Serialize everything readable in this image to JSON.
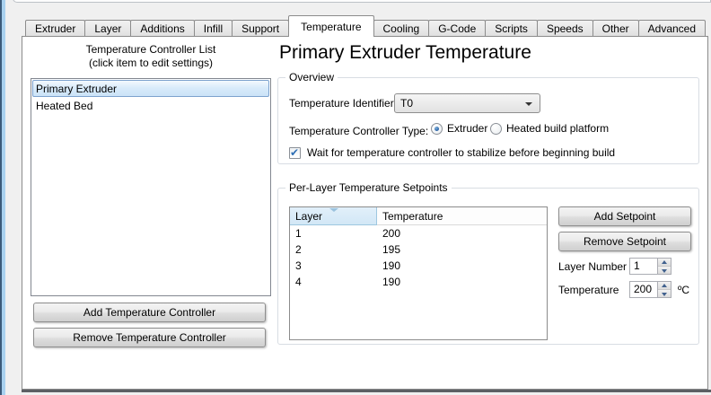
{
  "tabs": {
    "items": [
      "Extruder",
      "Layer",
      "Additions",
      "Infill",
      "Support",
      "Temperature",
      "Cooling",
      "G-Code",
      "Scripts",
      "Speeds",
      "Other",
      "Advanced"
    ],
    "active": "Temperature"
  },
  "left_panel": {
    "title": "Temperature Controller List",
    "subtitle": "(click item to edit settings)",
    "controllers": [
      {
        "label": "Primary Extruder",
        "selected": true
      },
      {
        "label": "Heated Bed",
        "selected": false
      }
    ],
    "add_button": "Add Temperature Controller",
    "remove_button": "Remove Temperature Controller"
  },
  "main": {
    "heading": "Primary Extruder Temperature",
    "overview": {
      "legend": "Overview",
      "identifier_label": "Temperature Identifier",
      "identifier_value": "T0",
      "type_label": "Temperature Controller Type:",
      "type_options": [
        {
          "label": "Extruder",
          "selected": true
        },
        {
          "label": "Heated build platform",
          "selected": false
        }
      ],
      "wait_checkbox": {
        "label": "Wait for temperature controller to stabilize before beginning build",
        "checked": true
      }
    },
    "setpoints": {
      "legend": "Per-Layer Temperature Setpoints",
      "table": {
        "columns": [
          "Layer",
          "Temperature"
        ],
        "sorted_column": "Layer",
        "sort_icon": "sort-indicator",
        "rows": [
          [
            "1",
            "200"
          ],
          [
            "2",
            "195"
          ],
          [
            "3",
            "190"
          ],
          [
            "4",
            "190"
          ]
        ]
      },
      "add_button": "Add Setpoint",
      "remove_button": "Remove Setpoint",
      "layer_number": {
        "label": "Layer Number",
        "value": "1"
      },
      "temperature": {
        "label": "Temperature",
        "value": "200",
        "unit": "ºC"
      }
    }
  },
  "colors": {
    "selection_border": "#7da2ce",
    "selection_fill": "#d7eafa",
    "sorted_header": "#d2e7f6",
    "accent_blue": "#2a62a5",
    "edge_blue": "#a9d1ef",
    "panel_border": "#8c8c8c"
  }
}
